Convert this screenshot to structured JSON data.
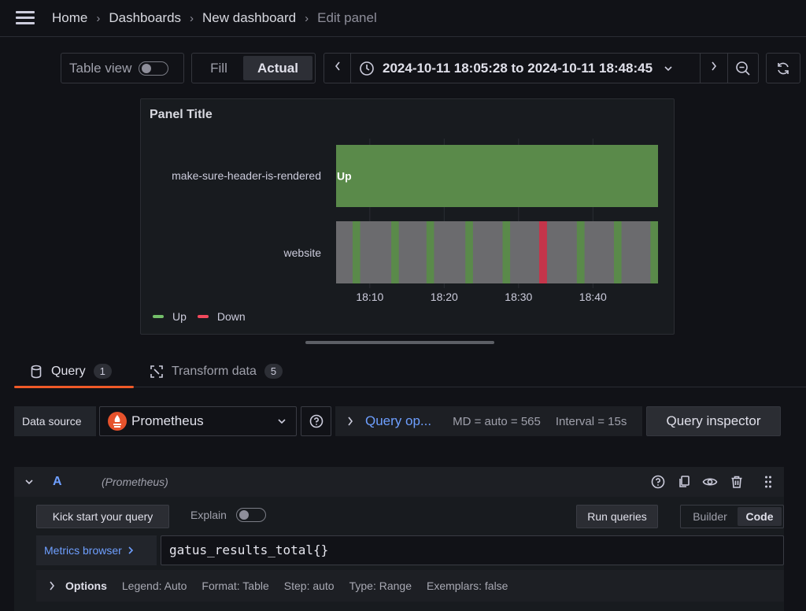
{
  "breadcrumbs": [
    "Home",
    "Dashboards",
    "New dashboard",
    "Edit panel"
  ],
  "toolbar": {
    "table_view_label": "Table view",
    "fill_label": "Fill",
    "actual_label": "Actual",
    "time_range": "2024-10-11 18:05:28 to 2024-10-11 18:48:45"
  },
  "panel": {
    "title": "Panel Title",
    "rows": [
      {
        "label": "make-sure-header-is-rendered",
        "value_label": "Up"
      },
      {
        "label": "website"
      }
    ],
    "x_ticks": [
      "18:10",
      "18:20",
      "18:30",
      "18:40"
    ],
    "legend": [
      {
        "label": "Up",
        "color": "#73bf69"
      },
      {
        "label": "Down",
        "color": "#f2495c"
      }
    ]
  },
  "chart_data": {
    "type": "state-timeline",
    "title": "Panel Title",
    "x_range": [
      "2024-10-11 18:05:28",
      "2024-10-11 18:48:45"
    ],
    "x_ticks": [
      "18:10",
      "18:20",
      "18:30",
      "18:40"
    ],
    "legend_position": "bottom-left",
    "states": {
      "Up": "#5a8a4a",
      "Down": "#c4354a",
      "none": "#6b6b6e"
    },
    "series": [
      {
        "name": "make-sure-header-is-rendered",
        "segments": [
          {
            "start": "18:05:28",
            "end": "18:48:45",
            "state": "Up"
          }
        ]
      },
      {
        "name": "website",
        "segments": [
          {
            "start": "18:07:41",
            "end": "18:08:42",
            "state": "Up"
          },
          {
            "start": "18:12:53",
            "end": "18:13:54",
            "state": "Up"
          },
          {
            "start": "18:17:37",
            "end": "18:18:38",
            "state": "Up"
          },
          {
            "start": "18:22:51",
            "end": "18:23:52",
            "state": "Up"
          },
          {
            "start": "18:27:51",
            "end": "18:28:52",
            "state": "Up"
          },
          {
            "start": "18:32:46",
            "end": "18:33:49",
            "state": "Down"
          },
          {
            "start": "18:37:50",
            "end": "18:38:52",
            "state": "Up"
          },
          {
            "start": "18:42:49",
            "end": "18:43:50",
            "state": "Up"
          },
          {
            "start": "18:47:44",
            "end": "18:48:45",
            "state": "Up"
          }
        ]
      }
    ]
  },
  "tabs": [
    {
      "label": "Query",
      "count": "1"
    },
    {
      "label": "Transform data",
      "count": "5"
    }
  ],
  "query_bar": {
    "data_source_label": "Data source",
    "data_source_value": "Prometheus",
    "query_options_label": "Query op...",
    "md_text": "MD = auto = 565",
    "interval_text": "Interval = 15s",
    "inspector_label": "Query inspector"
  },
  "query": {
    "ref_id": "A",
    "datasource_hint": "(Prometheus)",
    "kick_start_label": "Kick start your query",
    "explain_label": "Explain",
    "run_label": "Run queries",
    "builder_label": "Builder",
    "code_label": "Code",
    "metrics_browser_label": "Metrics browser",
    "expression": "gatus_results_total{}",
    "options_label": "Options",
    "options_items": [
      "Legend: Auto",
      "Format: Table",
      "Step: auto",
      "Type: Range",
      "Exemplars: false"
    ]
  }
}
